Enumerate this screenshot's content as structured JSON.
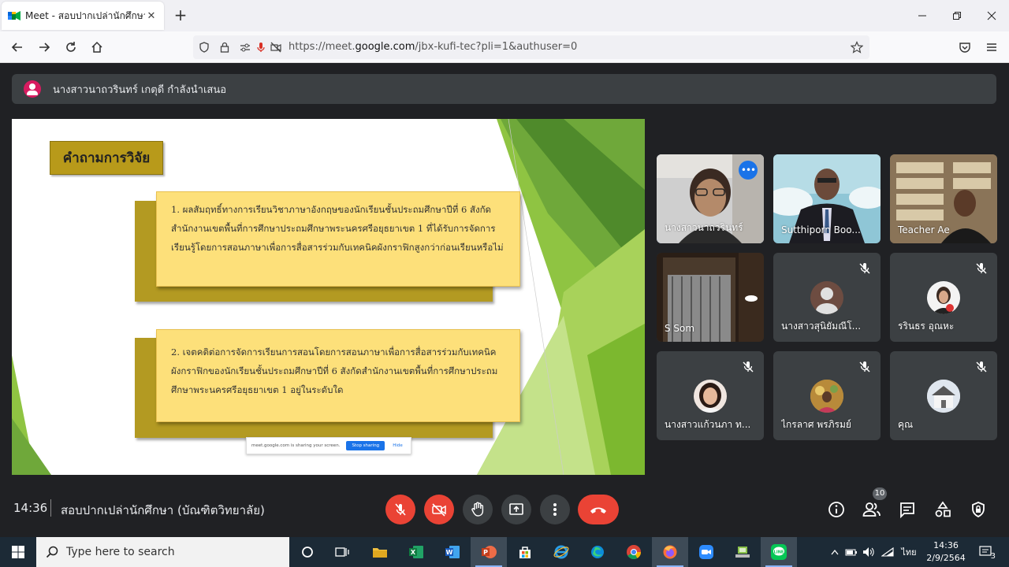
{
  "browser": {
    "tab_title": "Meet - สอบปากเปล่านักศึกษา (บัณ",
    "tab_close": "✕",
    "new_tab": "+",
    "url_prefix": "https://meet.",
    "url_domain": "google.com",
    "url_suffix": "/jbx-kufi-tec?pli=1&authuser=0"
  },
  "meet": {
    "presenter_text": "นางสาวนาถวรินทร์ เกตุดี กำลังนำเสนอ",
    "time": "14:36",
    "meeting_name": "สอบปากเปล่านักศึกษา (บัณฑิตวิทยาลัย)",
    "participants_count": "10"
  },
  "slide": {
    "title": "คำถามการวิจัย",
    "question1": "1. ผลสัมฤทธิ์ทางการเรียนวิชาภาษาอังกฤษของนักเรียนชั้นประถมศึกษาปีที่ 6 สังกัดสำนักงานเขตพื้นที่การศึกษาประถมศึกษาพระนครศรีอยุธยาเขต 1 ที่ได้รับการจัดการเรียนรู้โดยการสอนภาษาเพื่อการสื่อสารร่วมกับเทคนิคผังกราฟิกสูงกว่าก่อนเรียนหรือไม่",
    "question2": "2. เจตคติต่อการจัดการเรียนการสอนโดยการสอนภาษาเพื่อการสื่อสารร่วมกับเทคนิคผังกราฟิกของนักเรียนชั้นประถมศึกษาปีที่ 6 สังกัดสำนักงานเขตพื้นที่การศึกษาประถมศึกษาพระนครศรีอยุธยาเขต 1 อยู่ในระดับใด",
    "share_text": "meet.google.com is sharing your screen.",
    "share_stop": "Stop sharing",
    "share_hide": "Hide"
  },
  "participants": [
    {
      "name": "นางสาวนาถวรินทร์",
      "type": "video",
      "active": true
    },
    {
      "name": "Sutthiporn Boo...",
      "type": "video"
    },
    {
      "name": "Teacher Ae",
      "type": "video"
    },
    {
      "name": "S Som",
      "type": "video"
    },
    {
      "name": "นางสาวสุนิยัมณีโ...",
      "type": "avatar",
      "muted": true
    },
    {
      "name": "รรินธร อุณหะ",
      "type": "avatar",
      "muted": true
    },
    {
      "name": "นางสาวแก้วนภา ท...",
      "type": "avatar",
      "muted": true
    },
    {
      "name": "ไกรลาศ พรภิรมย์",
      "type": "avatar",
      "muted": true
    },
    {
      "name": "คุณ",
      "type": "avatar",
      "muted": true
    }
  ],
  "taskbar": {
    "search_placeholder": "Type here to search",
    "time": "14:36",
    "date": "2/9/2564",
    "lang": "ไทย",
    "notif_count": "3"
  },
  "colors": {
    "meet_bg": "#202124",
    "tile_bg": "#3c4043",
    "red": "#ea4335",
    "slide_green": "#7cb82f",
    "box_yellow": "#fde07a"
  }
}
